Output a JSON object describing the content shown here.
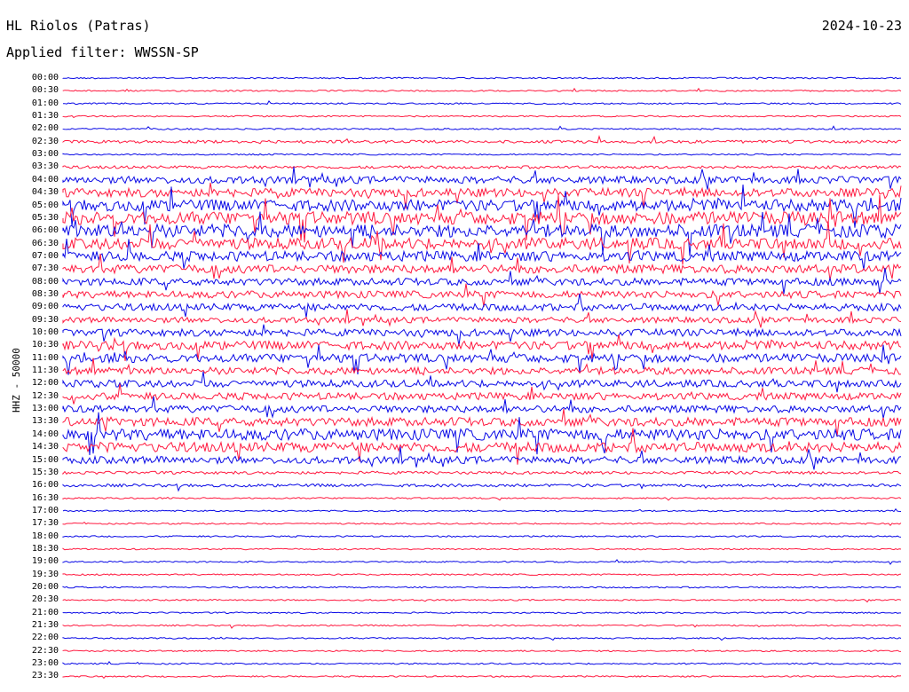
{
  "header": {
    "station": "HL Riolos (Patras)",
    "date": "2024-10-23",
    "filter": "Applied filter: WWSSN-SP"
  },
  "axis": {
    "channel_label": "HHZ - 50000"
  },
  "colors": {
    "trace_a": "#0a0ae6",
    "trace_b": "#ff1a40",
    "background": "#ffffff"
  },
  "time_labels": [
    "00:00",
    "00:30",
    "01:00",
    "01:30",
    "02:00",
    "02:30",
    "03:00",
    "03:30",
    "04:00",
    "04:30",
    "05:00",
    "05:30",
    "06:00",
    "06:30",
    "07:00",
    "07:30",
    "08:00",
    "08:30",
    "09:00",
    "09:30",
    "10:00",
    "10:30",
    "11:00",
    "11:30",
    "12:00",
    "12:30",
    "13:00",
    "13:30",
    "14:00",
    "14:30",
    "15:00",
    "15:30",
    "16:00",
    "16:30",
    "17:00",
    "17:30",
    "18:00",
    "18:30",
    "19:00",
    "19:30",
    "20:00",
    "20:30",
    "21:00",
    "21:30",
    "22:00",
    "22:30",
    "23:00",
    "23:30"
  ],
  "trace_activity": [
    1,
    1,
    1,
    1,
    1,
    2,
    1,
    2,
    5,
    6,
    8,
    9,
    9,
    8,
    7,
    6,
    5,
    5,
    5,
    4,
    5,
    6,
    6,
    5,
    5,
    5,
    5,
    6,
    8,
    7,
    5,
    2,
    2,
    1,
    1,
    1,
    1,
    1,
    1,
    1,
    1,
    1,
    1,
    1,
    1,
    1,
    1,
    1
  ]
}
